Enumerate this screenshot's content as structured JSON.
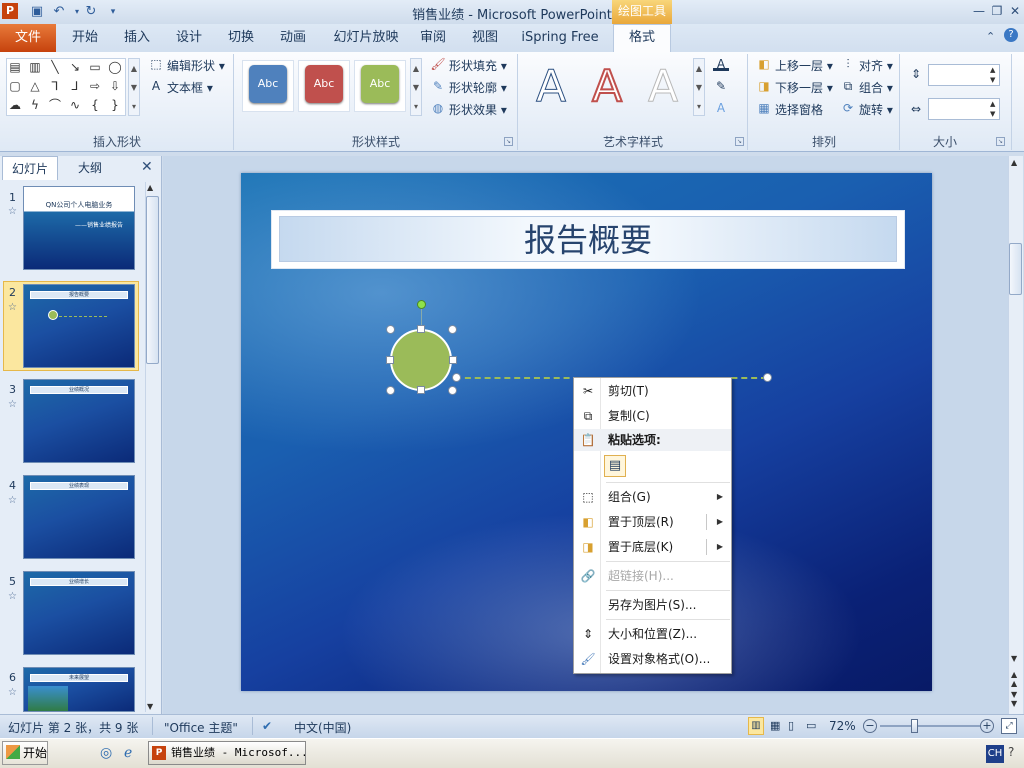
{
  "window": {
    "title": "销售业绩  -  Microsoft PowerPoint",
    "context_tab": "绘图工具"
  },
  "tabs": [
    "文件",
    "开始",
    "插入",
    "设计",
    "切换",
    "动画",
    "幻灯片放映",
    "审阅",
    "视图",
    "iSpring Free",
    "格式"
  ],
  "ribbon": {
    "insert_shapes": {
      "label": "插入形状",
      "edit_shape": "编辑形状",
      "text_box": "文本框"
    },
    "shape_styles": {
      "label": "形状样式",
      "samples": [
        "Abc",
        "Abc",
        "Abc"
      ],
      "fill": "形状填充",
      "outline": "形状轮廓",
      "effects": "形状效果"
    },
    "wordart_styles": {
      "label": "艺术字样式",
      "samples": [
        "A",
        "A",
        "A"
      ]
    },
    "arrange": {
      "label": "排列",
      "bring_forward": "上移一层",
      "send_backward": "下移一层",
      "selection_pane": "选择窗格",
      "align": "对齐",
      "group": "组合",
      "rotate": "旋转"
    },
    "size": {
      "label": "大小"
    }
  },
  "left_pane": {
    "tab_slides": "幻灯片",
    "tab_outline": "大纲",
    "slides": [
      {
        "num": "1",
        "title": "QN公司个人电脑业务",
        "subtitle": "——销售业绩报告"
      },
      {
        "num": "2",
        "title": "报告概要"
      },
      {
        "num": "3",
        "title": "业绩概况"
      },
      {
        "num": "4",
        "title": "业绩表现"
      },
      {
        "num": "5",
        "title": "业绩增长"
      },
      {
        "num": "6",
        "title": "未来展望"
      }
    ]
  },
  "slide": {
    "title": "报告概要"
  },
  "context_menu": {
    "cut": "剪切(T)",
    "copy": "复制(C)",
    "paste_options": "粘贴选项:",
    "group": "组合(G)",
    "bring_to_front": "置于顶层(R)",
    "send_to_back": "置于底层(K)",
    "hyperlink": "超链接(H)...",
    "save_as_picture": "另存为图片(S)...",
    "size_position": "大小和位置(Z)...",
    "format_object": "设置对象格式(O)..."
  },
  "status": {
    "slide_info": "幻灯片 第 2 张，共 9 张",
    "theme": "\"Office 主题\"",
    "language": "中文(中国)",
    "zoom": "72%"
  },
  "taskbar": {
    "start": "开始",
    "item": "销售业绩 - Microsof...",
    "ime": "CH"
  },
  "colors": {
    "accent_orange": "#c6420d",
    "shape_green": "#9bbb59",
    "abc_blue": "#4f81bd",
    "abc_red": "#c0504d",
    "abc_green": "#9bbb59"
  }
}
